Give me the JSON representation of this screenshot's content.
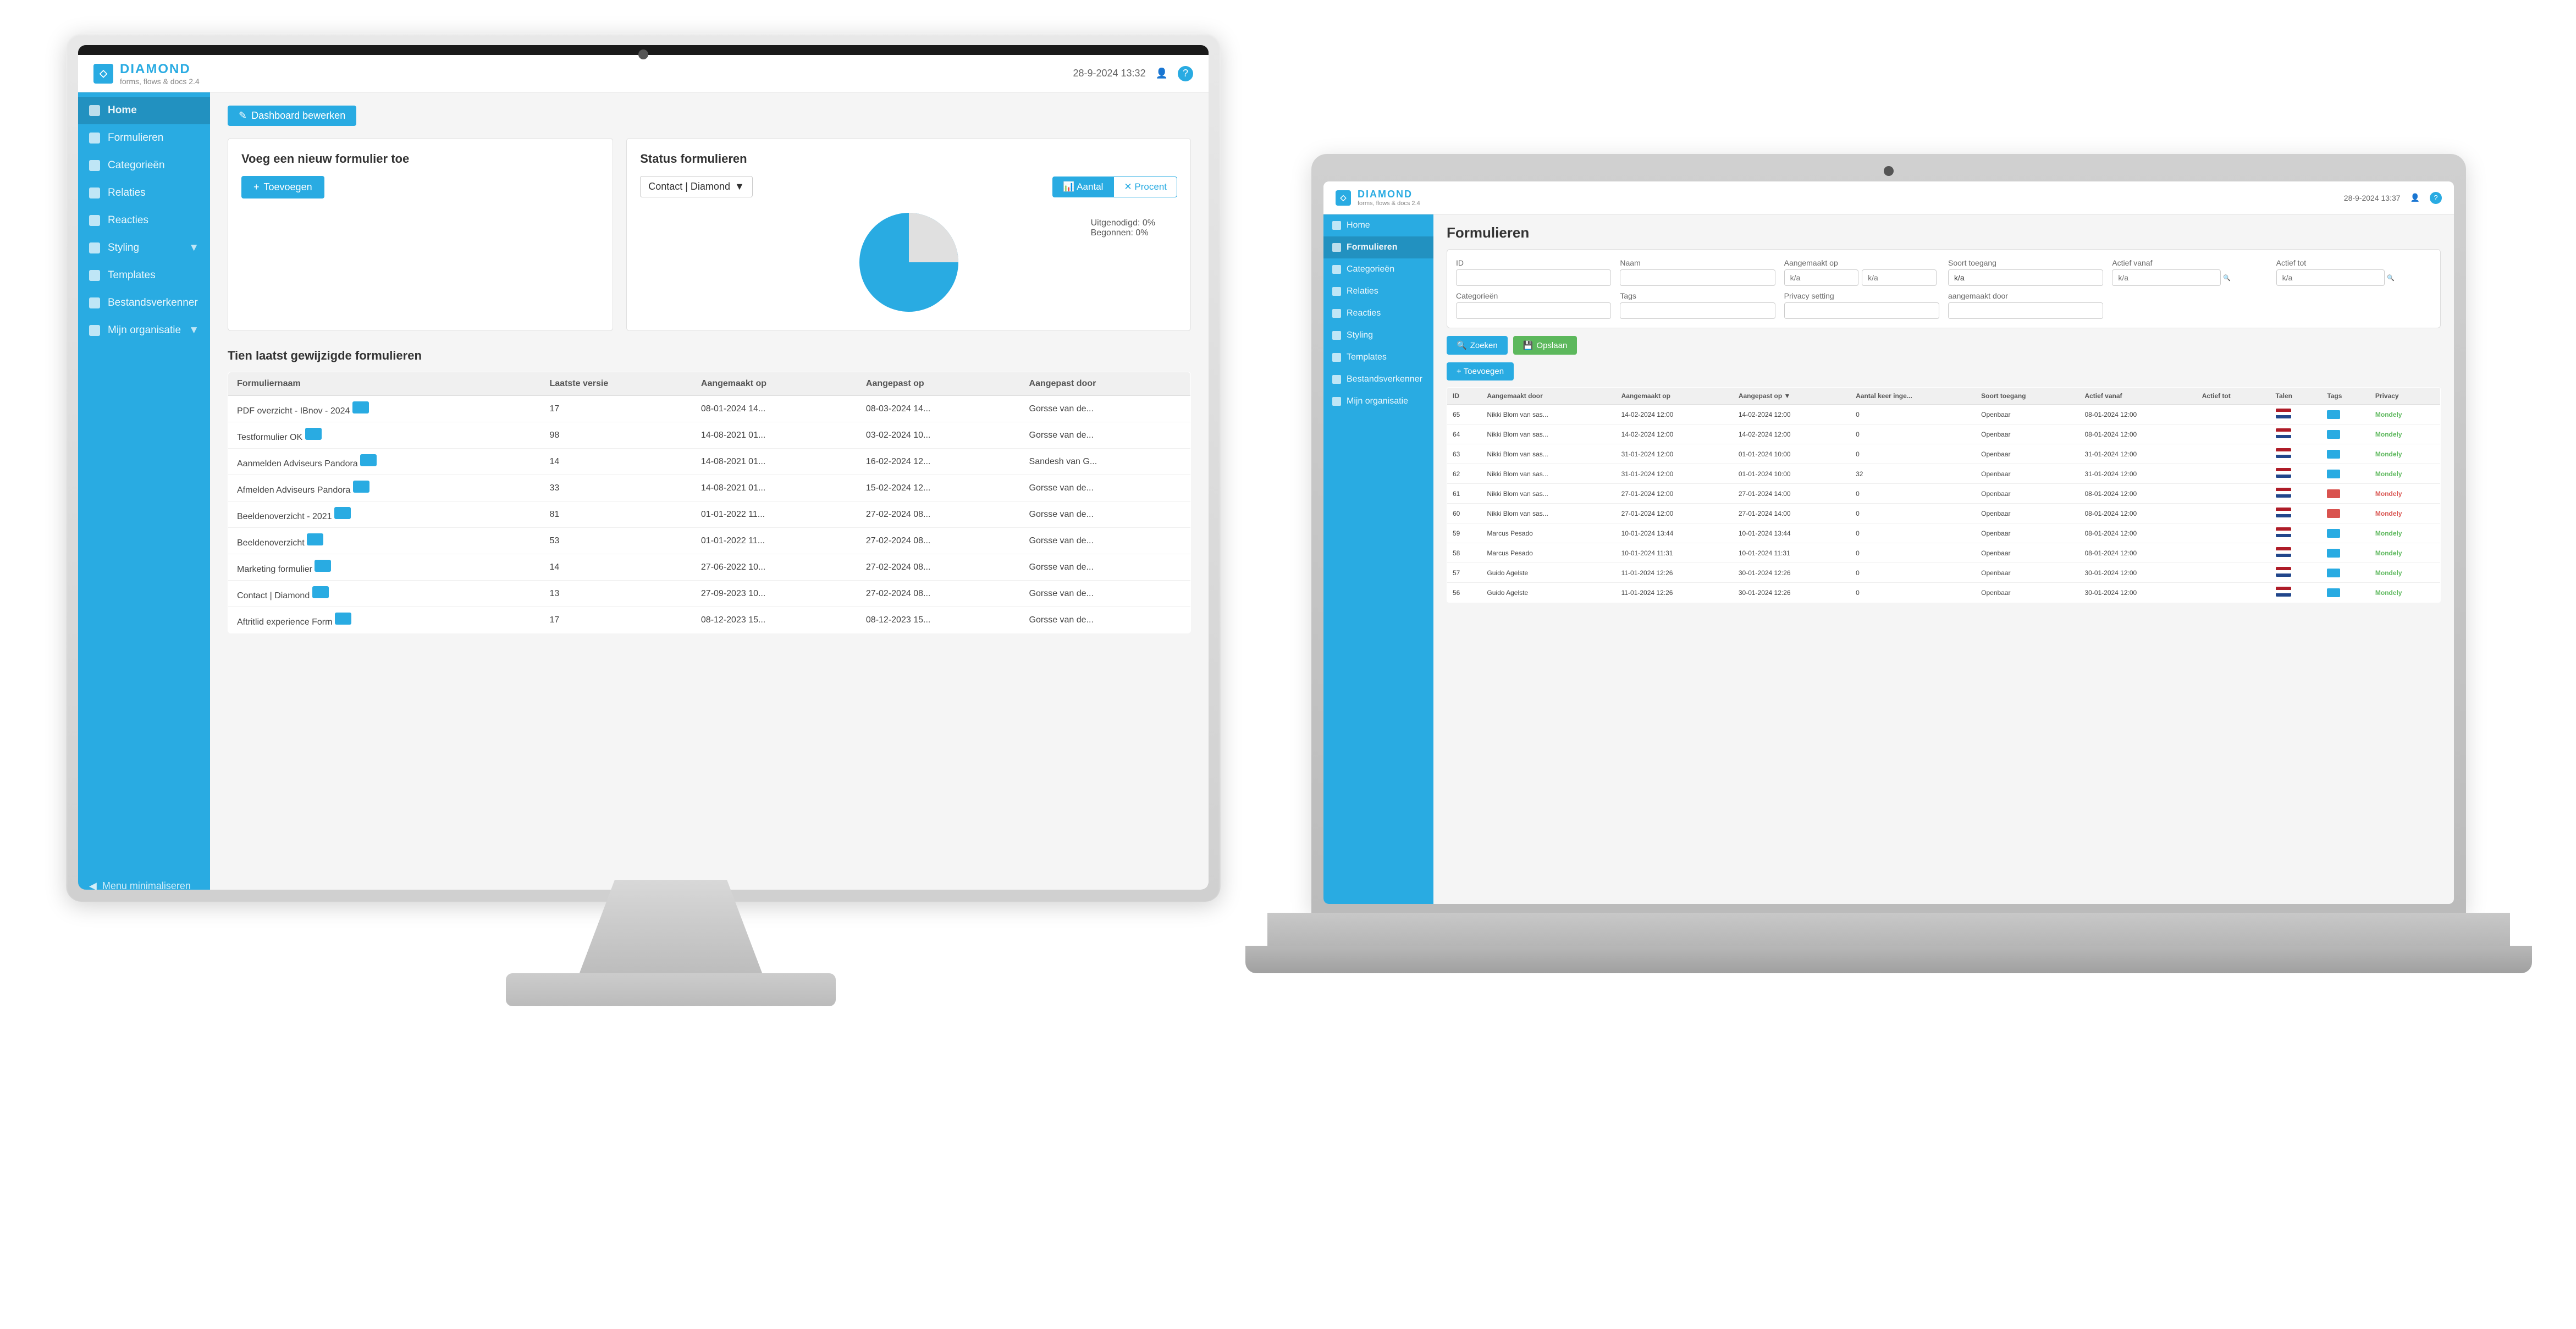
{
  "monitor": {
    "header": {
      "logo_name": "DIAMOND",
      "logo_sub": "forms, flows & docs   2.4",
      "datetime": "28-9-2024 13:32"
    },
    "sidebar": {
      "items": [
        {
          "label": "Home",
          "active": true
        },
        {
          "label": "Formulieren",
          "active": false
        },
        {
          "label": "Categorieën",
          "active": false
        },
        {
          "label": "Relaties",
          "active": false
        },
        {
          "label": "Reacties",
          "active": false
        },
        {
          "label": "Styling",
          "active": false
        },
        {
          "label": "Templates",
          "active": false
        },
        {
          "label": "Bestandsverkenner",
          "active": false
        },
        {
          "label": "Mijn organisatie",
          "active": false
        }
      ],
      "minimize_label": "Menu minimaliseren"
    },
    "dashboard": {
      "edit_button": "Dashboard bewerken",
      "left_panel_title": "Voeg een nieuw formulier toe",
      "add_button": "+ Toevoegen",
      "right_panel_title": "Status formulieren",
      "dropdown_value": "Contact | Diamond",
      "btn_aantal": "Aantal",
      "btn_procent": "Procent",
      "chart_label_uitgenodigd": "Uitgenodigd: 0%",
      "chart_label_begonnen": "Begonnen: 0%"
    },
    "recent_table": {
      "title": "Tien laatst gewijzigde formulieren",
      "columns": [
        "Formuliernaam",
        "Laatste versie",
        "Aangemaakt op",
        "Aangepast op",
        "Aangepast door"
      ],
      "rows": [
        [
          "PDF overzicht - IBnov - 2024",
          "17",
          "08-01-2024 14...",
          "08-03-2024 14...",
          "Gorsse van de..."
        ],
        [
          "Testformulier OK",
          "98",
          "14-08-2021 01...",
          "03-02-2024 10...",
          "Gorsse van de..."
        ],
        [
          "Aanmelden Adviseurs Pandora",
          "14",
          "14-08-2021 01...",
          "16-02-2024 12...",
          "Sandesh van G..."
        ],
        [
          "Afmelden Adviseurs Pandora",
          "33",
          "14-08-2021 01...",
          "15-02-2024 12...",
          "Gorsse van de..."
        ],
        [
          "Beeldenoverzicht - 2021",
          "81",
          "01-01-2022 11...",
          "27-02-2024 08...",
          "Gorsse van de..."
        ],
        [
          "Beeldenoverzicht",
          "53",
          "01-01-2022 11...",
          "27-02-2024 08...",
          "Gorsse van de..."
        ],
        [
          "Marketing formulier",
          "14",
          "27-06-2022 10...",
          "27-02-2024 08...",
          "Gorsse van de..."
        ],
        [
          "Contact | Diamond",
          "13",
          "27-09-2023 10...",
          "27-02-2024 08...",
          "Gorsse van de..."
        ],
        [
          "Aftritlid experience Form",
          "17",
          "08-12-2023 15...",
          "08-12-2023 15...",
          "Gorsse van de..."
        ]
      ]
    }
  },
  "laptop": {
    "header": {
      "logo_name": "DIAMOND",
      "logo_sub": "forms, flows & docs   2.4",
      "datetime": "28-9-2024 13:37"
    },
    "sidebar": {
      "items": [
        {
          "label": "Home",
          "active": false
        },
        {
          "label": "Formulieren",
          "active": true
        },
        {
          "label": "Categorieën",
          "active": false
        },
        {
          "label": "Relaties",
          "active": false
        },
        {
          "label": "Reacties",
          "active": false
        },
        {
          "label": "Styling",
          "active": false
        },
        {
          "label": "Templates",
          "active": false
        },
        {
          "label": "Bestandsverkenner",
          "active": false
        },
        {
          "label": "Mijn organisatie",
          "active": false
        }
      ]
    },
    "formulieren": {
      "title": "Formulieren",
      "filters": {
        "id_label": "ID",
        "naam_label": "Naam",
        "aangemaakt_op_label": "Aangemaakt op",
        "soort_toegang_label": "Soort toegang",
        "actief_vanaf_label": "Actief vanaf",
        "actief_tot_label": "Actief tot",
        "categorieen_label": "Categorieën",
        "tags_label": "Tags",
        "privacy_label": "Privacy setting",
        "aangemaakt_door_label": "aangemaakt door",
        "aa_placeholder": "k/a",
        "btn_zoeken": "Zoeken",
        "btn_opslaan": "Opslaan"
      },
      "add_button": "+ Toevoegen",
      "table": {
        "columns": [
          "ID",
          "Aangemaakt door",
          "Aangemaakt op",
          "Aangepast op ▼",
          "Aantal keer inge...",
          "Soort toegang",
          "Actief vanaf",
          "Actief tot",
          "Talen",
          "Tags",
          "Privacy"
        ],
        "rows": [
          {
            "id": "65",
            "door": "Nikki Blom van sas...",
            "aangemaakt": "14-02-2024 12:00",
            "aangepast": "14-02-2024 12:00",
            "keer": "0",
            "toegang": "Openbaar",
            "vanaf": "08-01-2024 12:00",
            "tot": "",
            "talen": "nl",
            "tags": "Mondely",
            "privacy": "green"
          },
          {
            "id": "64",
            "door": "Nikki Blom van sas...",
            "aangemaakt": "14-02-2024 12:00",
            "aangepast": "14-02-2024 12:00",
            "keer": "0",
            "toegang": "Openbaar",
            "vanaf": "08-01-2024 12:00",
            "tot": "",
            "talen": "nl",
            "tags": "Mondely",
            "privacy": "green"
          },
          {
            "id": "63",
            "door": "Nikki Blom van sas...",
            "aangemaakt": "31-01-2024 12:00",
            "aangepast": "01-01-2024 10:00",
            "keer": "0",
            "toegang": "Openbaar",
            "vanaf": "31-01-2024 12:00",
            "tot": "",
            "talen": "nl",
            "tags": "Mondely",
            "privacy": "green"
          },
          {
            "id": "62",
            "door": "Nikki Blom van sas...",
            "aangemaakt": "31-01-2024 12:00",
            "aangepast": "01-01-2024 10:00",
            "keer": "32",
            "toegang": "Openbaar",
            "vanaf": "31-01-2024 12:00",
            "tot": "",
            "talen": "nl",
            "tags": "Mondely",
            "privacy": "green"
          },
          {
            "id": "61",
            "door": "Nikki Blom van sas...",
            "aangemaakt": "27-01-2024 12:00",
            "aangepast": "27-01-2024 14:00",
            "keer": "0",
            "toegang": "Openbaar",
            "vanaf": "08-01-2024 12:00",
            "tot": "",
            "talen": "nl",
            "tags": "Mondely",
            "privacy": "red"
          },
          {
            "id": "60",
            "door": "Nikki Blom van sas...",
            "aangemaakt": "27-01-2024 12:00",
            "aangepast": "27-01-2024 14:00",
            "keer": "0",
            "toegang": "Openbaar",
            "vanaf": "08-01-2024 12:00",
            "tot": "",
            "talen": "nl",
            "tags": "Mondely",
            "privacy": "red"
          },
          {
            "id": "59",
            "door": "Marcus Pesado",
            "aangemaakt": "10-01-2024 13:44",
            "aangepast": "10-01-2024 13:44",
            "keer": "0",
            "toegang": "Openbaar",
            "vanaf": "08-01-2024 12:00",
            "tot": "",
            "talen": "nl",
            "tags": "Mondely",
            "privacy": "green"
          },
          {
            "id": "58",
            "door": "Marcus Pesado",
            "aangemaakt": "10-01-2024 11:31",
            "aangepast": "10-01-2024 11:31",
            "keer": "0",
            "toegang": "Openbaar",
            "vanaf": "08-01-2024 12:00",
            "tot": "",
            "talen": "nl",
            "tags": "Mondely",
            "privacy": "green"
          },
          {
            "id": "57",
            "door": "Guido Agelste",
            "aangemaakt": "11-01-2024 12:26",
            "aangepast": "30-01-2024 12:26",
            "keer": "0",
            "toegang": "Openbaar",
            "vanaf": "30-01-2024 12:00",
            "tot": "",
            "talen": "nl",
            "tags": "Mondely",
            "privacy": "green"
          },
          {
            "id": "56",
            "door": "Guido Agelste",
            "aangemaakt": "11-01-2024 12:26",
            "aangepast": "30-01-2024 12:26",
            "keer": "0",
            "toegang": "Openbaar",
            "vanaf": "30-01-2024 12:00",
            "tot": "",
            "talen": "nl",
            "tags": "Mondely",
            "privacy": "green"
          }
        ]
      }
    }
  }
}
